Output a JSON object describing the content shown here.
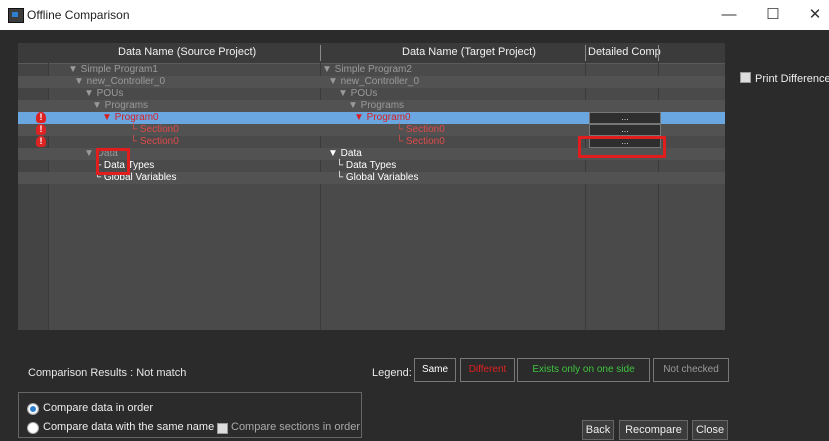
{
  "window": {
    "title": "Offline Comparison"
  },
  "grid": {
    "headers": {
      "source": "Data Name (Source Project)",
      "target": "Data Name (Target Project)",
      "detail": "Detailed Comp"
    },
    "rows": [
      {
        "src": "▼ Simple Program1",
        "tgt": "▼ Simple Program2",
        "srcStyle": "dim",
        "tgtStyle": "dim",
        "alt": false
      },
      {
        "src": "▼ new_Controller_0",
        "tgt": "▼ new_Controller_0",
        "srcStyle": "dim",
        "tgtStyle": "dim",
        "alt": true
      },
      {
        "src": "▼ POUs",
        "tgt": "▼ POUs",
        "srcStyle": "dim",
        "tgtStyle": "dim",
        "alt": false
      },
      {
        "src": "▼ Programs",
        "tgt": "▼ Programs",
        "srcStyle": "dim",
        "tgtStyle": "dim",
        "alt": true
      },
      {
        "src": "▼ Program0",
        "tgt": "▼ Program0",
        "srcStyle": "red",
        "tgtStyle": "red",
        "selected": true,
        "error": true,
        "detail": "..."
      },
      {
        "src": "└ Section0",
        "tgt": "└ Section0",
        "srcStyle": "red",
        "tgtStyle": "red",
        "alt": true,
        "error": true,
        "detail": "..."
      },
      {
        "src": "└ Section0",
        "tgt": "└ Section0",
        "srcStyle": "red",
        "tgtStyle": "red",
        "alt": false,
        "error": true,
        "detail": "..."
      },
      {
        "src": "▼ Data",
        "tgt": "▼ Data",
        "srcStyle": "dim",
        "tgtStyle": "white",
        "alt": true
      },
      {
        "src": "└ Data Types",
        "tgt": "└ Data Types",
        "srcStyle": "white",
        "tgtStyle": "white",
        "alt": false
      },
      {
        "src": "└ Global Variables",
        "tgt": "└ Global Variables",
        "srcStyle": "white",
        "tgtStyle": "white",
        "alt": true
      }
    ]
  },
  "options": {
    "print_differences": "Print Differences"
  },
  "results": {
    "text": "Comparison Results :  Not match"
  },
  "legend": {
    "label": "Legend:",
    "same": "Same",
    "different": "Different",
    "exists_one_side": "Exists only on one side",
    "not_checked": "Not checked"
  },
  "compare_options": {
    "in_order": "Compare data in order",
    "same_name": "Compare data with the same name",
    "sections_in_order": "Compare sections in order"
  },
  "buttons": {
    "back": "Back",
    "recompare": "Recompare",
    "close": "Close"
  },
  "colors": {
    "accent": "#2f7fd1",
    "selected_row": "#6aa7e0",
    "error": "#d22222",
    "highlight": "#e21d1d",
    "exists_only": "#3ec43e"
  },
  "icons": {
    "error": "error-icon",
    "checkbox": "checkbox-icon",
    "radio": "radio-icon"
  }
}
